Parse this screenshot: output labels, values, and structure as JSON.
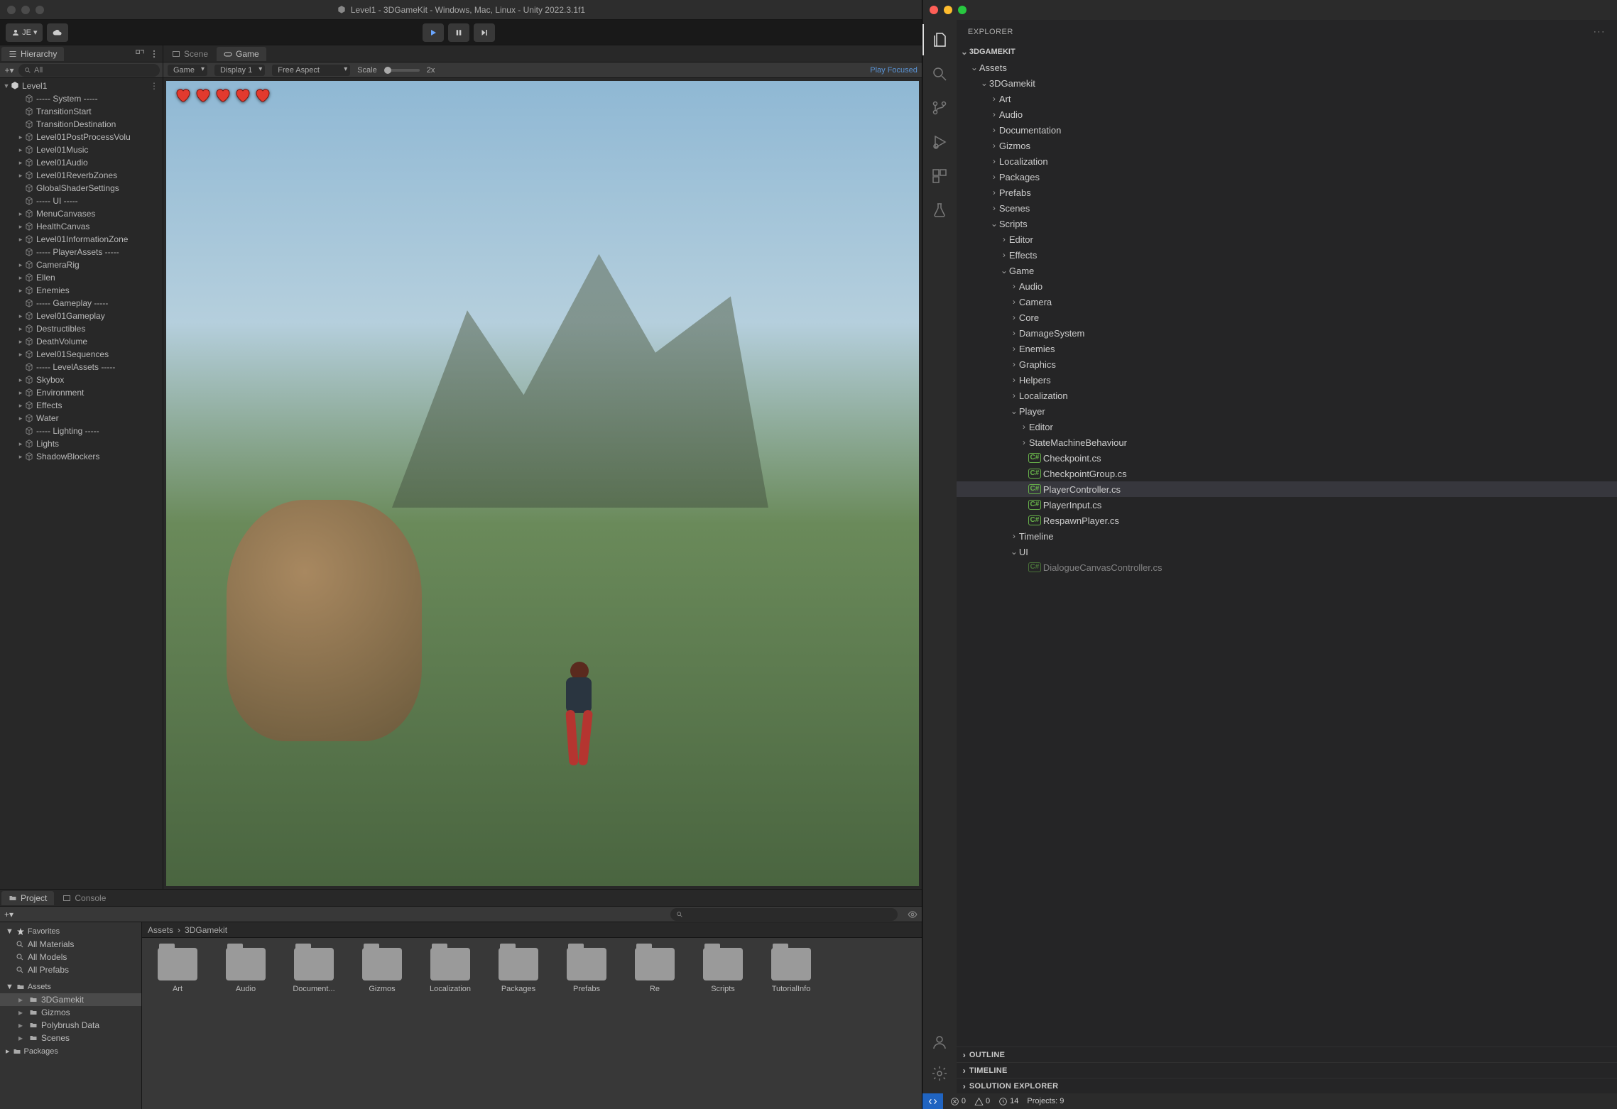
{
  "unity": {
    "title": "Level1 - 3DGameKit - Windows, Mac, Linux - Unity 2022.3.1f1",
    "account_label": "JE",
    "hierarchy": {
      "label": "Hierarchy",
      "search_placeholder": "All",
      "scene": "Level1",
      "items": [
        {
          "label": "----- System -----",
          "indent": 1,
          "arrow": false
        },
        {
          "label": "TransitionStart",
          "indent": 1,
          "arrow": false
        },
        {
          "label": "TransitionDestination",
          "indent": 1,
          "arrow": false
        },
        {
          "label": "Level01PostProcessVolu",
          "indent": 1,
          "arrow": true
        },
        {
          "label": "Level01Music",
          "indent": 1,
          "arrow": true
        },
        {
          "label": "Level01Audio",
          "indent": 1,
          "arrow": true
        },
        {
          "label": "Level01ReverbZones",
          "indent": 1,
          "arrow": true
        },
        {
          "label": "GlobalShaderSettings",
          "indent": 1,
          "arrow": false
        },
        {
          "label": "----- UI -----",
          "indent": 1,
          "arrow": false
        },
        {
          "label": "MenuCanvases",
          "indent": 1,
          "arrow": true
        },
        {
          "label": "HealthCanvas",
          "indent": 1,
          "arrow": true
        },
        {
          "label": "Level01InformationZone",
          "indent": 1,
          "arrow": true
        },
        {
          "label": "----- PlayerAssets -----",
          "indent": 1,
          "arrow": false
        },
        {
          "label": "CameraRig",
          "indent": 1,
          "arrow": true
        },
        {
          "label": "Ellen",
          "indent": 1,
          "arrow": true
        },
        {
          "label": "Enemies",
          "indent": 1,
          "arrow": true
        },
        {
          "label": "----- Gameplay -----",
          "indent": 1,
          "arrow": false
        },
        {
          "label": "Level01Gameplay",
          "indent": 1,
          "arrow": true
        },
        {
          "label": "Destructibles",
          "indent": 1,
          "arrow": true
        },
        {
          "label": "DeathVolume",
          "indent": 1,
          "arrow": true
        },
        {
          "label": "Level01Sequences",
          "indent": 1,
          "arrow": true
        },
        {
          "label": "----- LevelAssets -----",
          "indent": 1,
          "arrow": false
        },
        {
          "label": "Skybox",
          "indent": 1,
          "arrow": true
        },
        {
          "label": "Environment",
          "indent": 1,
          "arrow": true
        },
        {
          "label": "Effects",
          "indent": 1,
          "arrow": true
        },
        {
          "label": "Water",
          "indent": 1,
          "arrow": true
        },
        {
          "label": "----- Lighting -----",
          "indent": 1,
          "arrow": false
        },
        {
          "label": "Lights",
          "indent": 1,
          "arrow": true
        },
        {
          "label": "ShadowBlockers",
          "indent": 1,
          "arrow": true
        }
      ]
    },
    "tabs": {
      "scene": "Scene",
      "game": "Game"
    },
    "game_ctrl": {
      "target": "Game",
      "display": "Display 1",
      "aspect": "Free Aspect",
      "scale_label": "Scale",
      "scale_val": "2x",
      "play_focused": "Play Focused"
    },
    "hearts": 5,
    "project": {
      "tabs": {
        "project": "Project",
        "console": "Console"
      },
      "favorites_label": "Favorites",
      "favorites": [
        "All Materials",
        "All Models",
        "All Prefabs"
      ],
      "assets_label": "Assets",
      "tree": [
        {
          "label": "3DGamekit",
          "sel": true
        },
        {
          "label": "Gizmos",
          "sel": false
        },
        {
          "label": "Polybrush Data",
          "sel": false
        },
        {
          "label": "Scenes",
          "sel": false
        }
      ],
      "packages_label": "Packages",
      "breadcrumb": [
        "Assets",
        "3DGamekit"
      ],
      "folders": [
        "Art",
        "Audio",
        "Document...",
        "Gizmos",
        "Localization",
        "Packages",
        "Prefabs",
        "Re",
        "Scripts",
        "TutorialInfo"
      ]
    }
  },
  "vscode": {
    "explorer_label": "EXPLORER",
    "root": "3DGAMEKIT",
    "tree": [
      {
        "label": "Assets",
        "depth": 0,
        "open": true,
        "type": "folder"
      },
      {
        "label": "3DGamekit",
        "depth": 1,
        "open": true,
        "type": "folder"
      },
      {
        "label": "Art",
        "depth": 2,
        "open": false,
        "type": "folder"
      },
      {
        "label": "Audio",
        "depth": 2,
        "open": false,
        "type": "folder"
      },
      {
        "label": "Documentation",
        "depth": 2,
        "open": false,
        "type": "folder"
      },
      {
        "label": "Gizmos",
        "depth": 2,
        "open": false,
        "type": "folder"
      },
      {
        "label": "Localization",
        "depth": 2,
        "open": false,
        "type": "folder"
      },
      {
        "label": "Packages",
        "depth": 2,
        "open": false,
        "type": "folder"
      },
      {
        "label": "Prefabs",
        "depth": 2,
        "open": false,
        "type": "folder"
      },
      {
        "label": "Scenes",
        "depth": 2,
        "open": false,
        "type": "folder"
      },
      {
        "label": "Scripts",
        "depth": 2,
        "open": true,
        "type": "folder"
      },
      {
        "label": "Editor",
        "depth": 3,
        "open": false,
        "type": "folder"
      },
      {
        "label": "Effects",
        "depth": 3,
        "open": false,
        "type": "folder"
      },
      {
        "label": "Game",
        "depth": 3,
        "open": true,
        "type": "folder"
      },
      {
        "label": "Audio",
        "depth": 4,
        "open": false,
        "type": "folder"
      },
      {
        "label": "Camera",
        "depth": 4,
        "open": false,
        "type": "folder"
      },
      {
        "label": "Core",
        "depth": 4,
        "open": false,
        "type": "folder"
      },
      {
        "label": "DamageSystem",
        "depth": 4,
        "open": false,
        "type": "folder"
      },
      {
        "label": "Enemies",
        "depth": 4,
        "open": false,
        "type": "folder"
      },
      {
        "label": "Graphics",
        "depth": 4,
        "open": false,
        "type": "folder"
      },
      {
        "label": "Helpers",
        "depth": 4,
        "open": false,
        "type": "folder"
      },
      {
        "label": "Localization",
        "depth": 4,
        "open": false,
        "type": "folder"
      },
      {
        "label": "Player",
        "depth": 4,
        "open": true,
        "type": "folder"
      },
      {
        "label": "Editor",
        "depth": 5,
        "open": false,
        "type": "folder"
      },
      {
        "label": "StateMachineBehaviour",
        "depth": 5,
        "open": false,
        "type": "folder"
      },
      {
        "label": "Checkpoint.cs",
        "depth": 5,
        "type": "cs"
      },
      {
        "label": "CheckpointGroup.cs",
        "depth": 5,
        "type": "cs"
      },
      {
        "label": "PlayerController.cs",
        "depth": 5,
        "type": "cs",
        "sel": true
      },
      {
        "label": "PlayerInput.cs",
        "depth": 5,
        "type": "cs"
      },
      {
        "label": "RespawnPlayer.cs",
        "depth": 5,
        "type": "cs"
      },
      {
        "label": "Timeline",
        "depth": 4,
        "open": false,
        "type": "folder"
      },
      {
        "label": "UI",
        "depth": 4,
        "open": true,
        "type": "folder"
      },
      {
        "label": "DialogueCanvasController.cs",
        "depth": 5,
        "type": "cs",
        "dim": true
      }
    ],
    "sections": [
      "OUTLINE",
      "TIMELINE",
      "SOLUTION EXPLORER"
    ],
    "status": {
      "errors": "0",
      "warnings": "0",
      "clock": "14",
      "projects": "Projects: 9"
    }
  }
}
